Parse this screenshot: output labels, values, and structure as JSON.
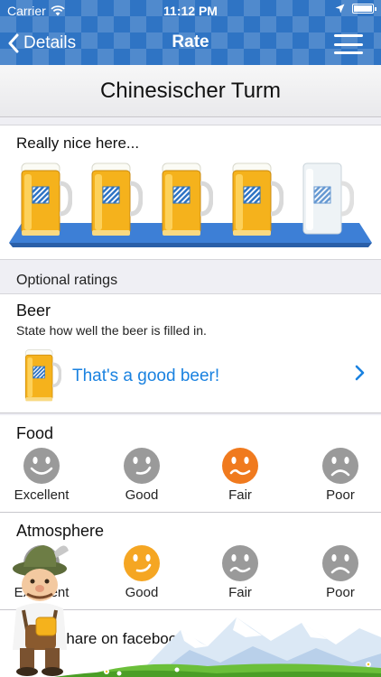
{
  "status": {
    "carrier": "Carrier",
    "time": "11:12 PM"
  },
  "nav": {
    "back_label": "Details",
    "title": "Rate"
  },
  "place": {
    "name": "Chinesischer Turm"
  },
  "main_rating": {
    "text": "Really nice here...",
    "value": 4,
    "max": 5
  },
  "optional": {
    "header": "Optional ratings"
  },
  "beer": {
    "heading": "Beer",
    "hint": "State how well the beer is filled in.",
    "row_label": "That's a good beer!"
  },
  "food": {
    "heading": "Food",
    "selected": "Fair",
    "options": [
      {
        "label": "Excellent"
      },
      {
        "label": "Good"
      },
      {
        "label": "Fair"
      },
      {
        "label": "Poor"
      }
    ]
  },
  "atmosphere": {
    "heading": "Atmosphere",
    "selected": "Good",
    "options": [
      {
        "label": "Excellent"
      },
      {
        "label": "Good"
      },
      {
        "label": "Fair"
      },
      {
        "label": "Poor"
      }
    ]
  },
  "share": {
    "label": "Share on facebook"
  },
  "colors": {
    "accent_blue": "#1a82e0",
    "nav_blue": "#2f74c4",
    "smiley_orange": "#f07a1e",
    "smiley_grey": "#9a9a9a",
    "beer_gold": "#f5b21c",
    "tray_blue": "#3d7fd6"
  },
  "icons": {
    "back": "chevron-left-icon",
    "menu": "hamburger-menu-icon",
    "wifi": "wifi-icon",
    "location": "location-arrow-icon",
    "battery": "battery-icon",
    "chevron": "chevron-right-icon"
  }
}
